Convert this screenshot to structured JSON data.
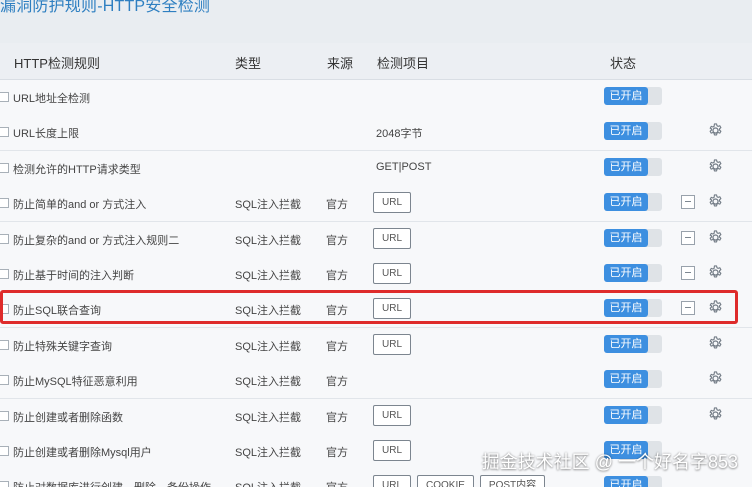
{
  "page": {
    "title": "漏洞防护规则-HTTP安全检测"
  },
  "table": {
    "headers": {
      "rule": "HTTP检测规则",
      "type": "类型",
      "source": "来源",
      "items": "检测项目",
      "status": "状态"
    },
    "rows": [
      {
        "name": "URL地址全检测",
        "type": "",
        "source": "",
        "detection_text": "",
        "tags": [],
        "status": "已开启",
        "show_minus": false,
        "show_gear": false,
        "highlighted": false
      },
      {
        "name": "URL长度上限",
        "type": "",
        "source": "",
        "detection_text": "2048字节",
        "tags": [],
        "status": "已开启",
        "show_minus": false,
        "show_gear": true,
        "highlighted": false
      },
      {
        "name": "检测允许的HTTP请求类型",
        "type": "",
        "source": "",
        "detection_text": "GET|POST",
        "tags": [],
        "status": "已开启",
        "show_minus": false,
        "show_gear": true,
        "highlighted": false
      },
      {
        "name": "防止简单的and or 方式注入",
        "type": "SQL注入拦截",
        "source": "官方",
        "detection_text": "",
        "tags": [
          "URL"
        ],
        "status": "已开启",
        "show_minus": true,
        "show_gear": true,
        "highlighted": false
      },
      {
        "name": "防止复杂的and or 方式注入规则二",
        "type": "SQL注入拦截",
        "source": "官方",
        "detection_text": "",
        "tags": [
          "URL"
        ],
        "status": "已开启",
        "show_minus": true,
        "show_gear": true,
        "highlighted": false
      },
      {
        "name": "防止基于时间的注入判断",
        "type": "SQL注入拦截",
        "source": "官方",
        "detection_text": "",
        "tags": [
          "URL"
        ],
        "status": "已开启",
        "show_minus": true,
        "show_gear": true,
        "highlighted": false
      },
      {
        "name": "防止SQL联合查询",
        "type": "SQL注入拦截",
        "source": "官方",
        "detection_text": "",
        "tags": [
          "URL"
        ],
        "status": "已开启",
        "show_minus": true,
        "show_gear": true,
        "highlighted": true
      },
      {
        "name": "防止特殊关键字查询",
        "type": "SQL注入拦截",
        "source": "官方",
        "detection_text": "",
        "tags": [
          "URL"
        ],
        "status": "已开启",
        "show_minus": false,
        "show_gear": true,
        "highlighted": false
      },
      {
        "name": "防止MySQL特征恶意利用",
        "type": "SQL注入拦截",
        "source": "官方",
        "detection_text": "",
        "tags": [],
        "status": "已开启",
        "show_minus": false,
        "show_gear": true,
        "highlighted": false
      },
      {
        "name": "防止创建或者删除函数",
        "type": "SQL注入拦截",
        "source": "官方",
        "detection_text": "",
        "tags": [
          "URL"
        ],
        "status": "已开启",
        "show_minus": false,
        "show_gear": true,
        "highlighted": false
      },
      {
        "name": "防止创建或者删除Mysql用户",
        "type": "SQL注入拦截",
        "source": "官方",
        "detection_text": "",
        "tags": [
          "URL"
        ],
        "status": "已开启",
        "show_minus": false,
        "show_gear": false,
        "highlighted": false
      },
      {
        "name": "防止对数据库进行创建、删除、备份操作",
        "type": "SQL注入拦截",
        "source": "官方",
        "detection_text": "",
        "tags": [
          "URL",
          "COOKIE",
          "POST内容"
        ],
        "status": "已开启",
        "show_minus": false,
        "show_gear": false,
        "highlighted": false
      }
    ]
  },
  "watermark": {
    "text": "掘金技术社区 @ 一个好名字853"
  }
}
